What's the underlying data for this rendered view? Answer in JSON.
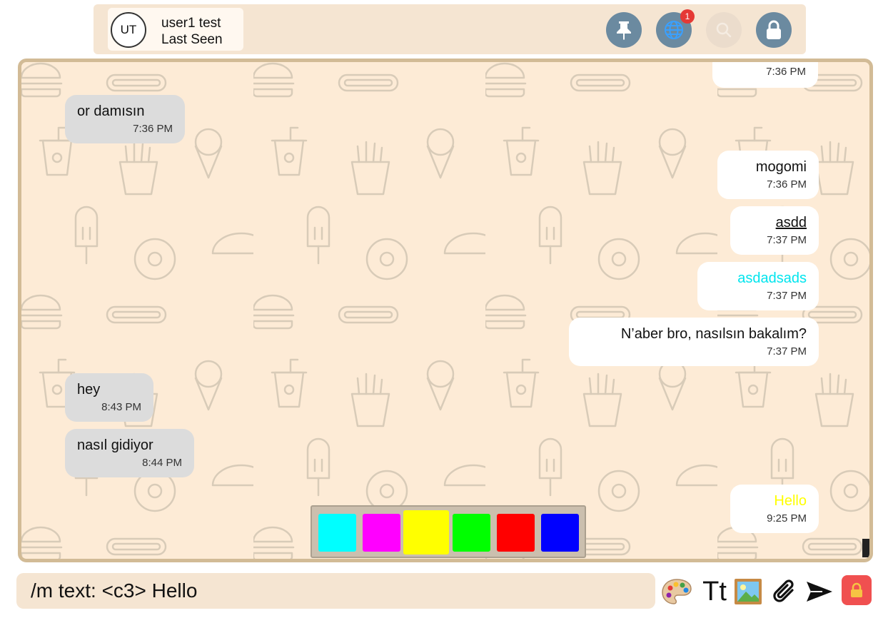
{
  "header": {
    "avatar_initials": "UT",
    "user_name": "user1 test",
    "user_status": "Last Seen",
    "notification_count": "1",
    "icons": [
      "pin-icon",
      "globe-icon",
      "search-icon",
      "lock-icon"
    ]
  },
  "messages": [
    {
      "text": "",
      "time": "7:36 PM",
      "direction": "out"
    },
    {
      "text": "or damısın",
      "time": "7:36 PM",
      "direction": "in"
    },
    {
      "text": "mogomi",
      "time": "7:36 PM",
      "direction": "out"
    },
    {
      "text": "asdd",
      "time": "7:37 PM",
      "direction": "out",
      "style": "underline"
    },
    {
      "text": "asdadsads",
      "time": "7:37 PM",
      "direction": "out",
      "color": "#00e5ee"
    },
    {
      "text": "N’aber bro, nasılsın bakalım?",
      "time": "7:37 PM",
      "direction": "out"
    },
    {
      "text": "hey",
      "time": "8:43 PM",
      "direction": "in"
    },
    {
      "text": "nasıl gidiyor",
      "time": "8:44 PM",
      "direction": "in"
    },
    {
      "text": "Hello",
      "time": "9:25 PM",
      "direction": "out",
      "color": "#ffff00"
    }
  ],
  "palette": {
    "colors": [
      "#00ffff",
      "#ff00ff",
      "#ffff00",
      "#00ff00",
      "#ff0000",
      "#0000ff"
    ],
    "selected": "#ffff00"
  },
  "composer": {
    "value": "/m text: <c3> Hello",
    "text_format_label": "Tt",
    "tools": [
      "palette-icon",
      "text-format-icon",
      "image-icon",
      "attach-icon",
      "send-icon",
      "lock-icon"
    ]
  },
  "colors": {
    "header_bg": "#f5e5d2",
    "chat_bg": "#fdebd6",
    "chat_border": "#d2bb96",
    "incoming_bubble": "#dcdcdc",
    "outgoing_bubble": "#ffffff",
    "icon_button": "#6b8aa0"
  }
}
